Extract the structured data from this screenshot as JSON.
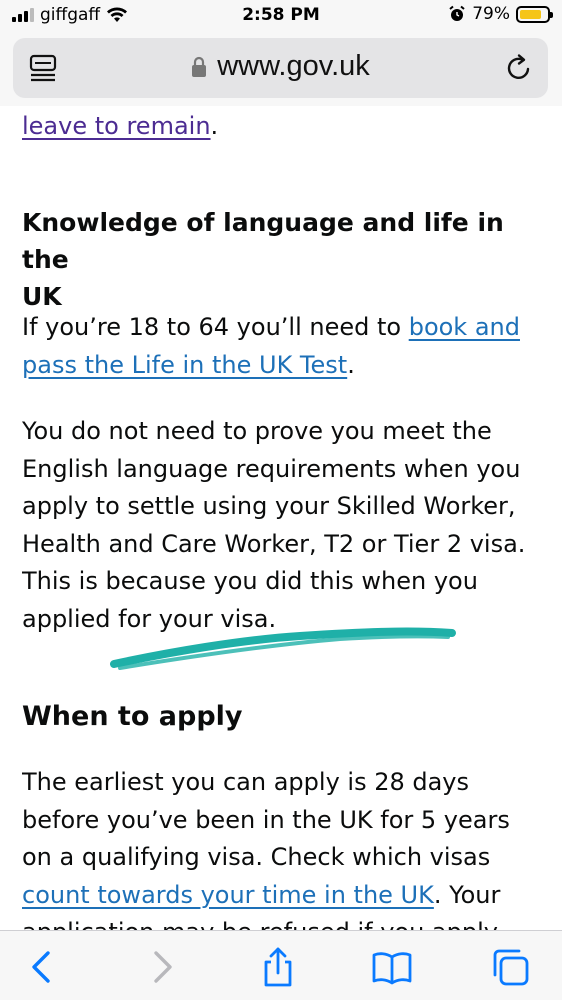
{
  "status_bar": {
    "carrier": "giffgaff",
    "time": "2:58 PM",
    "battery_percent": "79%",
    "battery_level": 0.79,
    "battery_color": "#f5c518"
  },
  "browser": {
    "url": "www.gov.uk",
    "icons": [
      "reader-icon",
      "lock-icon",
      "reload-icon"
    ]
  },
  "content": {
    "top_fragment": {
      "link_text": "leave to remain",
      "after": "."
    },
    "section_language": {
      "heading_line1": "Knowledge of language and life in the",
      "heading_line2": "UK",
      "para1_before": "If you’re 18 to 64 you’ll need to ",
      "para1_link_line1": "book and",
      "para1_link_line2": "pass the Life in the UK Test",
      "para1_after": ".",
      "para2_lines": [
        "You do not need to prove you meet the",
        "English language requirements when you",
        "apply to settle using your Skilled Worker,",
        "Health and Care Worker, T2 or Tier 2 visa.",
        "This is because you did this when you",
        "applied for your visa."
      ]
    },
    "section_when": {
      "heading": "When to apply",
      "lines": [
        "The earliest you can apply is 28 days",
        "before you’ve been in the UK for 5 years",
        "on a qualifying visa. Check which visas"
      ],
      "link_text": "count towards your time in the UK",
      "after_link": ". Your",
      "cutoff_line": "application may be refused if you apply"
    }
  },
  "colors": {
    "link": "#1d70b8",
    "visited_link": "#4c2c92",
    "text": "#0b0c0c",
    "annotation_stroke": "#1fb0a8",
    "ios_blue": "#0a7aff"
  },
  "toolbar": {
    "icons": [
      "back-icon",
      "forward-icon",
      "share-icon",
      "bookmarks-icon",
      "tabs-icon"
    ]
  }
}
